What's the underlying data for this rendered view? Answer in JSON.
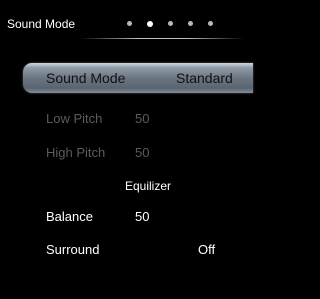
{
  "header": {
    "title": "Sound Mode",
    "page_count": 5,
    "active_page": 2
  },
  "menu": {
    "sound_mode": {
      "label": "Sound Mode",
      "value": "Standard"
    },
    "low_pitch": {
      "label": "Low Pitch",
      "value": "50"
    },
    "high_pitch": {
      "label": "High Pitch",
      "value": "50"
    },
    "equalizer": {
      "label": "Equilizer"
    },
    "balance": {
      "label": "Balance",
      "value": "50"
    },
    "surround": {
      "label": "Surround",
      "value": "Off"
    }
  }
}
